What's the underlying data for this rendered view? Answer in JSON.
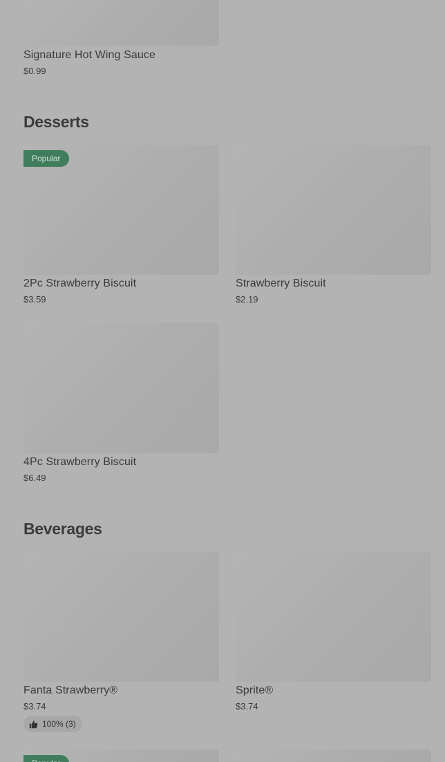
{
  "sections": {
    "top": {
      "items": [
        {
          "name": "Signature Hot Wing Sauce",
          "price": "$0.99"
        }
      ]
    },
    "desserts": {
      "title": "Desserts",
      "items": [
        {
          "name": "2Pc Strawberry Biscuit",
          "price": "$3.59",
          "badge": "Popular"
        },
        {
          "name": "Strawberry Biscuit",
          "price": "$2.19"
        },
        {
          "name": "4Pc Strawberry Biscuit",
          "price": "$6.49"
        }
      ]
    },
    "beverages": {
      "title": "Beverages",
      "items": [
        {
          "name": "Fanta Strawberry®",
          "price": "$3.74",
          "rating": "100% (3)",
          "rating_icon": "thumbs-up-icon"
        },
        {
          "name": "Sprite®",
          "price": "$3.74"
        },
        {
          "badge": "Popular"
        }
      ]
    }
  },
  "colors": {
    "background": "#b3b3b3",
    "badge_bg": "#3f7d5c",
    "text": "#3a3a3a"
  }
}
